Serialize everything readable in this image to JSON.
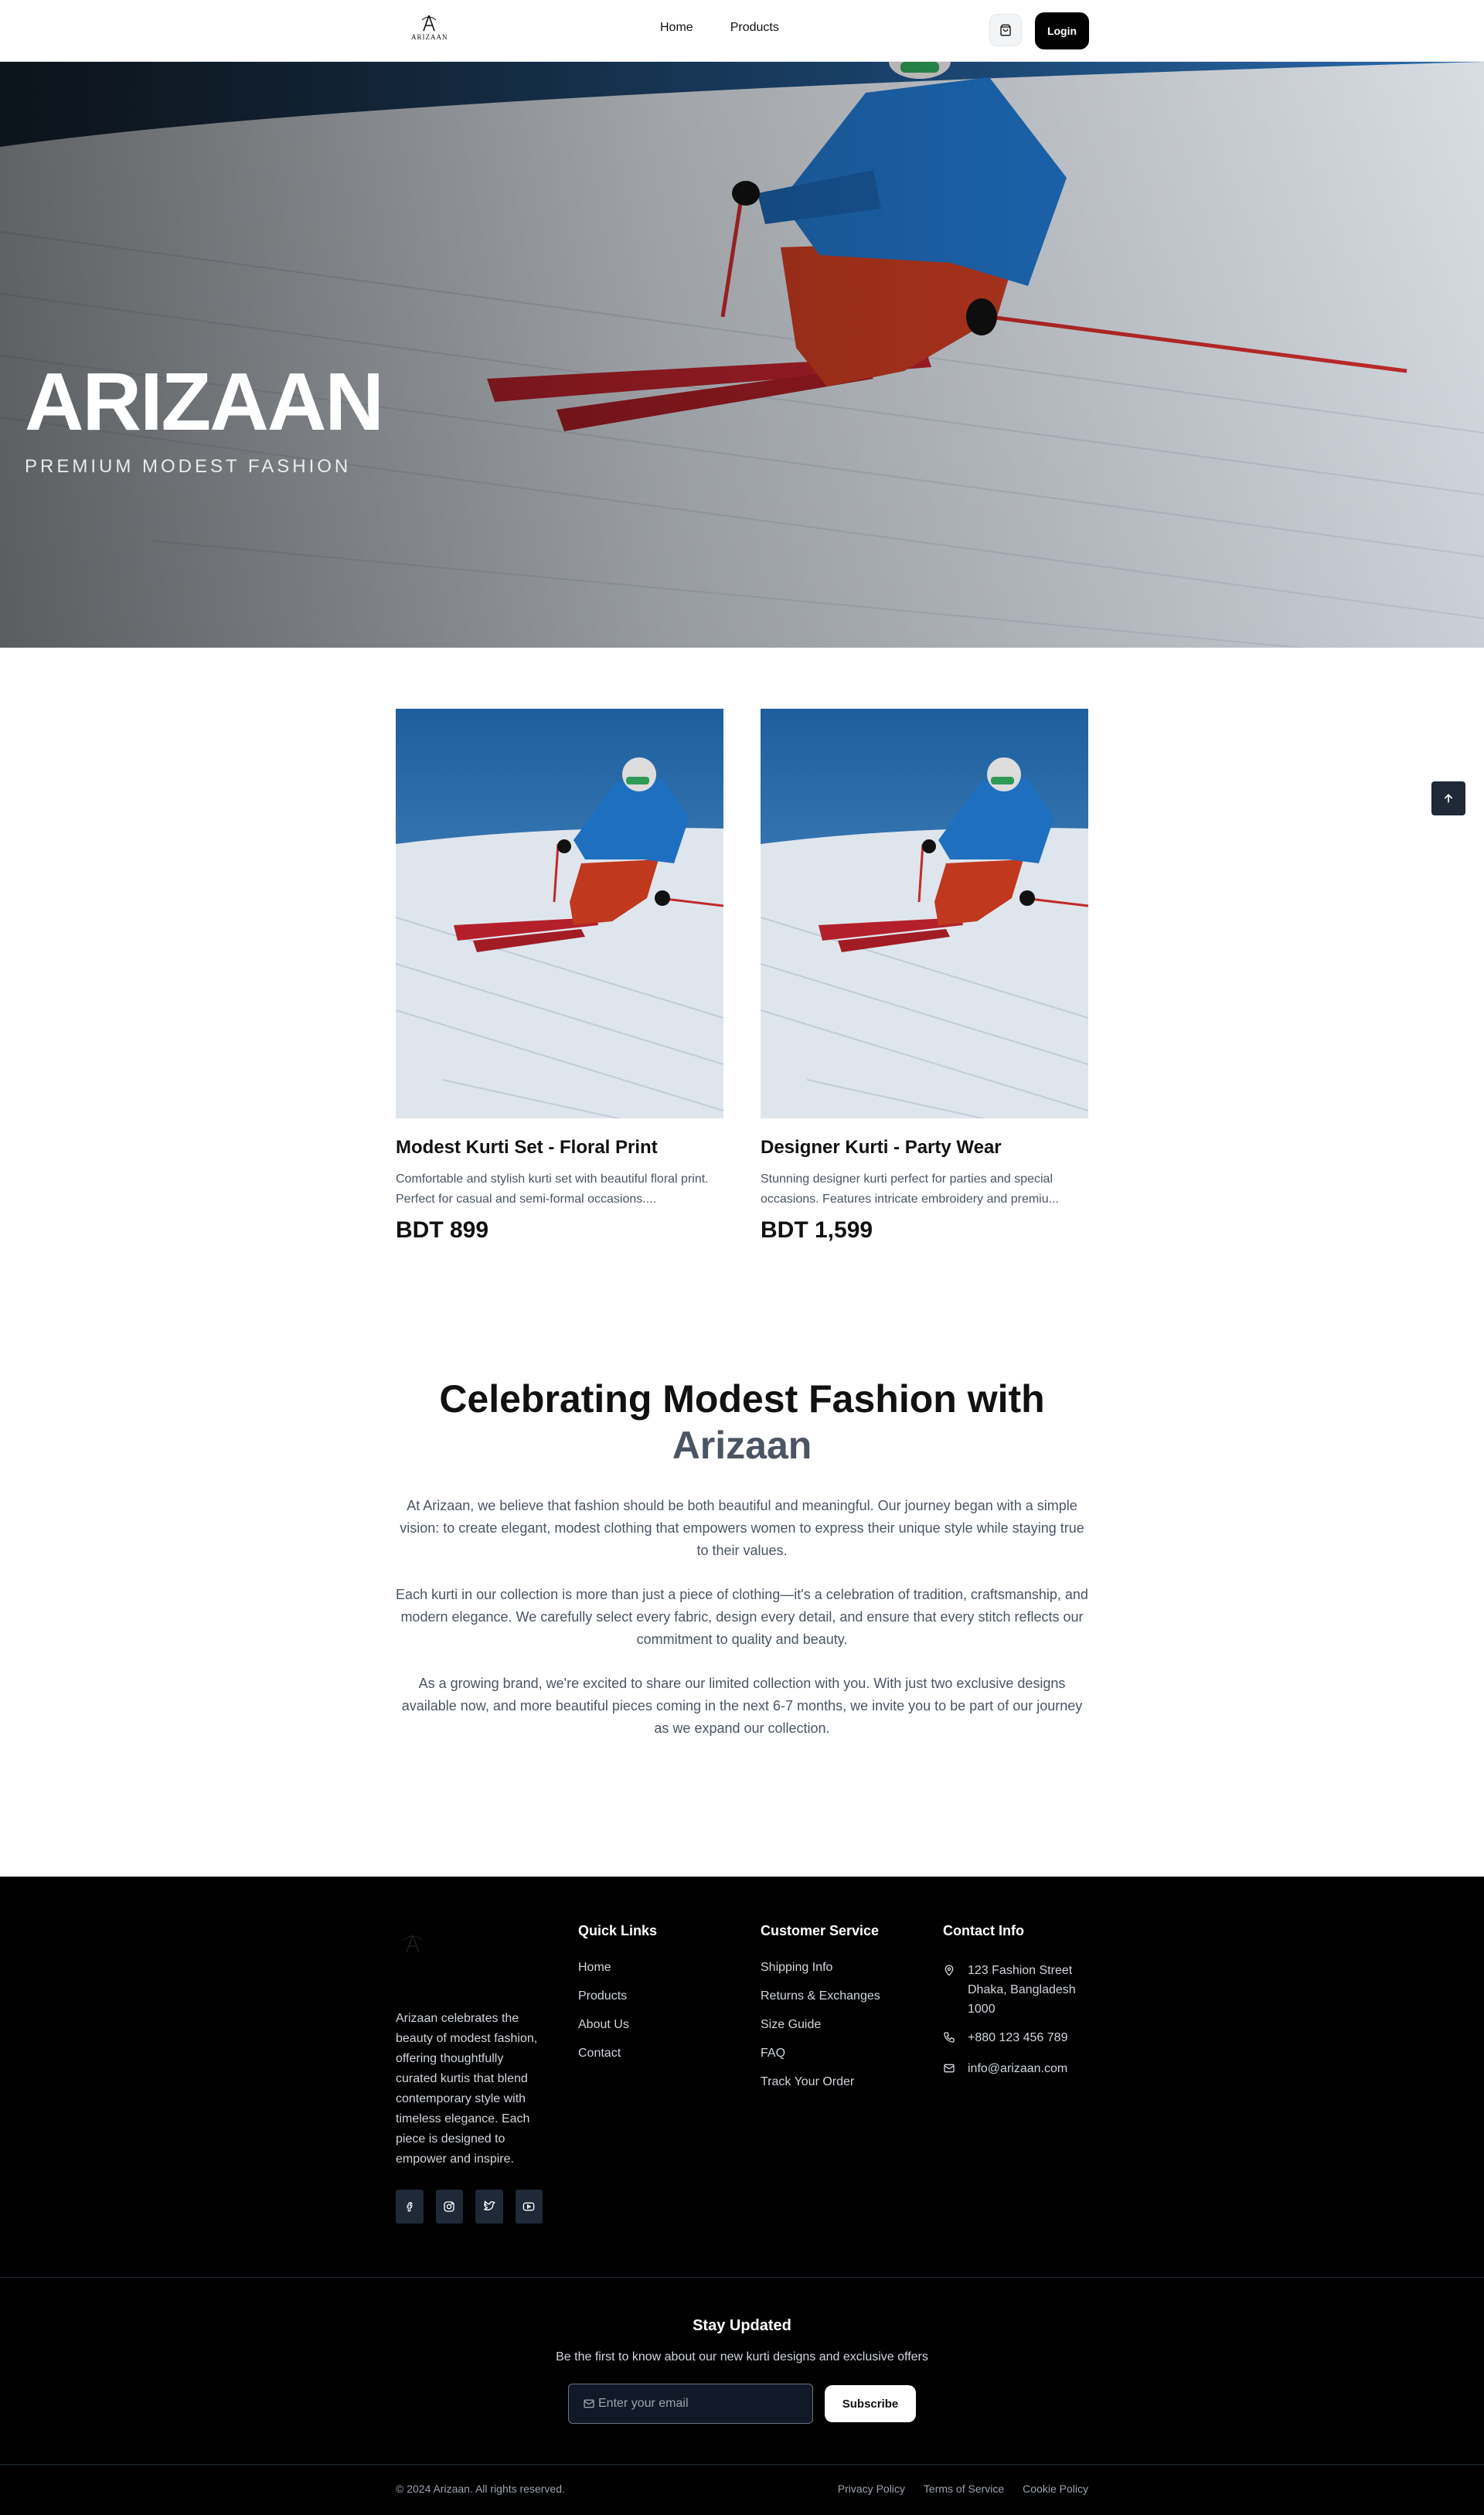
{
  "nav": {
    "logo_text": "ARIZAAN",
    "links": [
      "Home",
      "Products"
    ],
    "login_label": "Login",
    "cart_icon": "shopping-bag-icon"
  },
  "hero": {
    "title": "ARIZAAN",
    "subtitle": "PREMIUM MODEST FASHION"
  },
  "products": [
    {
      "name": "Modest Kurti Set - Floral Print",
      "description": "Comfortable and stylish kurti set with beautiful floral print. Perfect for casual and semi-formal occasions....",
      "price": "BDT 899"
    },
    {
      "name": "Designer Kurti - Party Wear",
      "description": "Stunning designer kurti perfect for parties and special occasions. Features intricate embroidery and premiu...",
      "price": "BDT 1,599"
    }
  ],
  "about": {
    "heading": "Celebrating Modest Fashion with",
    "heading_accent": "Arizaan",
    "paragraphs": [
      "At Arizaan, we believe that fashion should be both beautiful and meaningful. Our journey began with a simple vision: to create elegant, modest clothing that empowers women to express their unique style while staying true to their values.",
      "Each kurti in our collection is more than just a piece of clothing—it's a celebration of tradition, craftsmanship, and modern elegance. We carefully select every fabric, design every detail, and ensure that every stitch reflects our commitment to quality and beauty.",
      "As a growing brand, we're excited to share our limited collection with you. With just two exclusive designs available now, and more beautiful pieces coming in the next 6-7 months, we invite you to be part of our journey as we expand our collection."
    ]
  },
  "footer": {
    "brand_text": "Arizaan celebrates the beauty of modest fashion, offering thoughtfully curated kurtis that blend contemporary style with timeless elegance. Each piece is designed to empower and inspire.",
    "socials": [
      "facebook-icon",
      "instagram-icon",
      "twitter-icon",
      "youtube-icon"
    ],
    "quick_links": {
      "title": "Quick Links",
      "items": [
        "Home",
        "Products",
        "About Us",
        "Contact"
      ]
    },
    "customer_service": {
      "title": "Customer Service",
      "items": [
        "Shipping Info",
        "Returns & Exchanges",
        "Size Guide",
        "FAQ",
        "Track Your Order"
      ]
    },
    "contact": {
      "title": "Contact Info",
      "address": "123 Fashion Street Dhaka, Bangladesh 1000",
      "phone": "+880 123 456 789",
      "email": "info@arizaan.com"
    },
    "newsletter": {
      "title": "Stay Updated",
      "text": "Be the first to know about our new kurti designs and exclusive offers",
      "placeholder": "Enter your email",
      "button": "Subscribe"
    },
    "copyright": "© 2024 Arizaan. All rights reserved.",
    "legal": [
      "Privacy Policy",
      "Terms of Service",
      "Cookie Policy"
    ]
  },
  "colors": {
    "footer_bg": "#000000",
    "accent_text": "#4b5563",
    "sky": "#2b74b8",
    "jacket": "#1f6fc0",
    "pants": "#c0391f"
  }
}
